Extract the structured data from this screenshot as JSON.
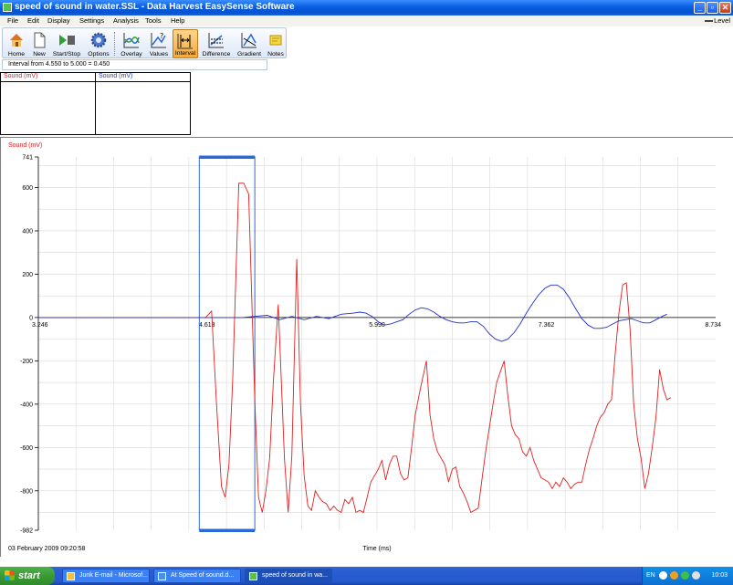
{
  "window": {
    "title": "speed of sound in water.SSL - Data Harvest EasySense Software",
    "min": "_",
    "max": "▫",
    "close": "✕"
  },
  "menu": {
    "items": [
      "File",
      "Edit",
      "Display",
      "Settings",
      "Analysis",
      "Tools",
      "Help"
    ],
    "level": "Level"
  },
  "toolbar": {
    "items": [
      {
        "label": "Home",
        "icon": "home-icon"
      },
      {
        "label": "New",
        "icon": "new-document-icon"
      },
      {
        "label": "Start/Stop",
        "icon": "start-stop-icon"
      },
      {
        "label": "Options",
        "icon": "gear-icon"
      },
      {
        "label": "Overlay",
        "icon": "overlay-icon"
      },
      {
        "label": "Values",
        "icon": "values-icon"
      },
      {
        "label": "Interval",
        "icon": "interval-icon",
        "active": true
      },
      {
        "label": "Difference",
        "icon": "difference-icon"
      },
      {
        "label": "Gradient",
        "icon": "gradient-icon"
      },
      {
        "label": "Notes",
        "icon": "notes-icon"
      }
    ]
  },
  "status": {
    "interval_text": "Interval from 4.550 to 5.000 = 0.450"
  },
  "value_boxes": [
    {
      "label": "Sound (mV)",
      "color": "#e02020"
    },
    {
      "label": "Sound (mV)",
      "color": "#2040c0"
    }
  ],
  "chart_data": {
    "type": "line",
    "ylabel": "Sound (mV)",
    "xlabel": "Time (ms)",
    "date_stamp": "03 February 2009  09:20:58",
    "ylim": [
      -982,
      741
    ],
    "xlim": [
      3.246,
      8.734
    ],
    "y_ticks": [
      741,
      600,
      400,
      200,
      0,
      -200,
      -400,
      -600,
      -800,
      -982
    ],
    "y_tick_labels": [
      "741",
      "600",
      "400",
      "200",
      "0",
      "-200",
      "-400",
      "-600",
      "-800",
      "-982"
    ],
    "x_tick_labels": [
      {
        "x": 3.246,
        "label": "3.246"
      },
      {
        "x": 4.613,
        "label": "4.613"
      },
      {
        "x": 5.99,
        "label": "5.990"
      },
      {
        "x": 7.362,
        "label": "7.362"
      },
      {
        "x": 8.734,
        "label": "8.734"
      }
    ],
    "grid": true,
    "interval": {
      "start": 4.55,
      "end": 5.0,
      "color": "#2a6ad8"
    },
    "series": [
      {
        "color": "#e02020",
        "points": [
          [
            3.246,
            0
          ],
          [
            4.55,
            0
          ],
          [
            4.6,
            0
          ],
          [
            4.65,
            30
          ],
          [
            4.69,
            -400
          ],
          [
            4.73,
            -780
          ],
          [
            4.76,
            -830
          ],
          [
            4.79,
            -680
          ],
          [
            4.82,
            -300
          ],
          [
            4.87,
            620
          ],
          [
            4.91,
            620
          ],
          [
            4.95,
            570
          ],
          [
            5.0,
            -380
          ],
          [
            5.03,
            -830
          ],
          [
            5.06,
            -900
          ],
          [
            5.09,
            -800
          ],
          [
            5.12,
            -650
          ],
          [
            5.15,
            -300
          ],
          [
            5.19,
            60
          ],
          [
            5.24,
            -650
          ],
          [
            5.27,
            -900
          ],
          [
            5.3,
            -640
          ],
          [
            5.34,
            270
          ],
          [
            5.37,
            -400
          ],
          [
            5.4,
            -730
          ],
          [
            5.43,
            -870
          ],
          [
            5.46,
            -890
          ],
          [
            5.49,
            -800
          ],
          [
            5.52,
            -830
          ],
          [
            5.55,
            -850
          ],
          [
            5.58,
            -860
          ],
          [
            5.61,
            -890
          ],
          [
            5.64,
            -870
          ],
          [
            5.67,
            -890
          ],
          [
            5.7,
            -900
          ],
          [
            5.73,
            -840
          ],
          [
            5.76,
            -860
          ],
          [
            5.79,
            -830
          ],
          [
            5.82,
            -900
          ],
          [
            5.85,
            -890
          ],
          [
            5.88,
            -900
          ],
          [
            5.91,
            -830
          ],
          [
            5.94,
            -760
          ],
          [
            5.97,
            -730
          ],
          [
            6.0,
            -700
          ],
          [
            6.03,
            -660
          ],
          [
            6.06,
            -750
          ],
          [
            6.09,
            -680
          ],
          [
            6.12,
            -640
          ],
          [
            6.15,
            -640
          ],
          [
            6.18,
            -720
          ],
          [
            6.21,
            -750
          ],
          [
            6.24,
            -740
          ],
          [
            6.27,
            -600
          ],
          [
            6.3,
            -450
          ],
          [
            6.33,
            -360
          ],
          [
            6.36,
            -280
          ],
          [
            6.39,
            -200
          ],
          [
            6.42,
            -450
          ],
          [
            6.45,
            -560
          ],
          [
            6.48,
            -620
          ],
          [
            6.51,
            -650
          ],
          [
            6.54,
            -680
          ],
          [
            6.57,
            -760
          ],
          [
            6.6,
            -700
          ],
          [
            6.63,
            -690
          ],
          [
            6.66,
            -780
          ],
          [
            6.69,
            -810
          ],
          [
            6.72,
            -850
          ],
          [
            6.75,
            -900
          ],
          [
            6.78,
            -890
          ],
          [
            6.81,
            -880
          ],
          [
            6.84,
            -750
          ],
          [
            6.87,
            -620
          ],
          [
            6.9,
            -510
          ],
          [
            6.93,
            -400
          ],
          [
            6.96,
            -300
          ],
          [
            6.99,
            -250
          ],
          [
            7.02,
            -200
          ],
          [
            7.05,
            -360
          ],
          [
            7.08,
            -500
          ],
          [
            7.11,
            -540
          ],
          [
            7.14,
            -560
          ],
          [
            7.17,
            -620
          ],
          [
            7.2,
            -640
          ],
          [
            7.23,
            -600
          ],
          [
            7.26,
            -660
          ],
          [
            7.29,
            -700
          ],
          [
            7.32,
            -740
          ],
          [
            7.35,
            -750
          ],
          [
            7.38,
            -760
          ],
          [
            7.41,
            -790
          ],
          [
            7.44,
            -760
          ],
          [
            7.47,
            -780
          ],
          [
            7.5,
            -740
          ],
          [
            7.53,
            -760
          ],
          [
            7.56,
            -790
          ],
          [
            7.59,
            -770
          ],
          [
            7.62,
            -760
          ],
          [
            7.65,
            -760
          ],
          [
            7.68,
            -680
          ],
          [
            7.71,
            -610
          ],
          [
            7.74,
            -560
          ],
          [
            7.77,
            -500
          ],
          [
            7.8,
            -460
          ],
          [
            7.83,
            -440
          ],
          [
            7.86,
            -400
          ],
          [
            7.89,
            -380
          ],
          [
            7.92,
            -170
          ],
          [
            7.95,
            20
          ],
          [
            7.98,
            150
          ],
          [
            8.01,
            160
          ],
          [
            8.04,
            -50
          ],
          [
            8.07,
            -400
          ],
          [
            8.1,
            -560
          ],
          [
            8.13,
            -650
          ],
          [
            8.16,
            -790
          ],
          [
            8.19,
            -720
          ],
          [
            8.22,
            -600
          ],
          [
            8.25,
            -460
          ],
          [
            8.28,
            -240
          ],
          [
            8.31,
            -330
          ],
          [
            8.34,
            -380
          ],
          [
            8.37,
            -370
          ]
        ]
      },
      {
        "color": "#2030c8",
        "points": [
          [
            3.246,
            0
          ],
          [
            4.9,
            0
          ],
          [
            5.0,
            5
          ],
          [
            5.1,
            10
          ],
          [
            5.2,
            -10
          ],
          [
            5.3,
            5
          ],
          [
            5.4,
            -10
          ],
          [
            5.5,
            5
          ],
          [
            5.6,
            -5
          ],
          [
            5.7,
            15
          ],
          [
            5.8,
            20
          ],
          [
            5.85,
            25
          ],
          [
            5.9,
            20
          ],
          [
            5.95,
            5
          ],
          [
            6.0,
            -20
          ],
          [
            6.05,
            -35
          ],
          [
            6.1,
            -30
          ],
          [
            6.15,
            -20
          ],
          [
            6.2,
            -10
          ],
          [
            6.25,
            15
          ],
          [
            6.3,
            35
          ],
          [
            6.35,
            45
          ],
          [
            6.4,
            40
          ],
          [
            6.45,
            25
          ],
          [
            6.5,
            5
          ],
          [
            6.55,
            -10
          ],
          [
            6.6,
            -20
          ],
          [
            6.65,
            -25
          ],
          [
            6.7,
            -25
          ],
          [
            6.75,
            -20
          ],
          [
            6.8,
            -20
          ],
          [
            6.85,
            -40
          ],
          [
            6.9,
            -75
          ],
          [
            6.95,
            -100
          ],
          [
            7.0,
            -110
          ],
          [
            7.05,
            -100
          ],
          [
            7.1,
            -70
          ],
          [
            7.15,
            -30
          ],
          [
            7.2,
            20
          ],
          [
            7.25,
            65
          ],
          [
            7.3,
            105
          ],
          [
            7.35,
            135
          ],
          [
            7.4,
            150
          ],
          [
            7.45,
            150
          ],
          [
            7.5,
            130
          ],
          [
            7.55,
            90
          ],
          [
            7.6,
            40
          ],
          [
            7.65,
            -5
          ],
          [
            7.7,
            -35
          ],
          [
            7.75,
            -50
          ],
          [
            7.8,
            -50
          ],
          [
            7.85,
            -45
          ],
          [
            7.9,
            -30
          ],
          [
            7.95,
            -15
          ],
          [
            8.0,
            -10
          ],
          [
            8.05,
            -5
          ],
          [
            8.1,
            -15
          ],
          [
            8.15,
            -25
          ],
          [
            8.2,
            -25
          ],
          [
            8.25,
            -10
          ],
          [
            8.3,
            5
          ],
          [
            8.34,
            15
          ]
        ]
      }
    ]
  },
  "taskbar": {
    "start": "start",
    "tasks": [
      {
        "label": "Junk E-mail - Microsof..."
      },
      {
        "label": "At Speed of sound.d..."
      },
      {
        "label": "speed of sound in wa...",
        "active": true
      }
    ],
    "lang": "EN",
    "clock": "10:03"
  }
}
